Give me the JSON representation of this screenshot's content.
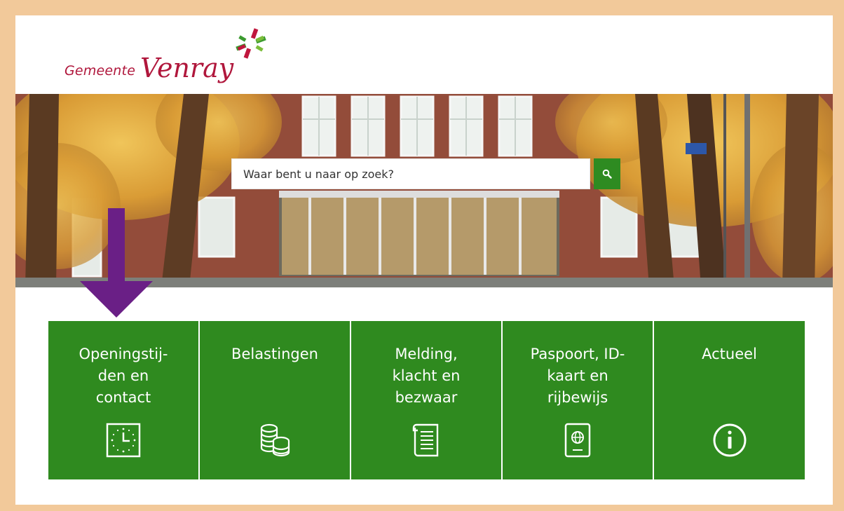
{
  "header": {
    "logo_prefix": "Gemeente",
    "logo_name": "Venray"
  },
  "search": {
    "placeholder": "Waar bent u naar op zoek?",
    "icon": "search-icon"
  },
  "annotation": {
    "arrow_color": "#6a1f86"
  },
  "tiles": [
    {
      "label": "Openingstij-\nden en\ncontact",
      "icon": "clock-icon"
    },
    {
      "label": "Belastingen",
      "icon": "coins-icon"
    },
    {
      "label": "Melding,\nklacht en\nbezwaar",
      "icon": "document-icon"
    },
    {
      "label": "Paspoort, ID-\nkaart en\nrijbewijs",
      "icon": "passport-icon"
    },
    {
      "label": "Actueel",
      "icon": "info-icon"
    }
  ],
  "colors": {
    "brand": "#b0173c",
    "tile_green": "#2f8a1f",
    "search_button": "#2e8b21",
    "frame": "#f2c99a"
  }
}
